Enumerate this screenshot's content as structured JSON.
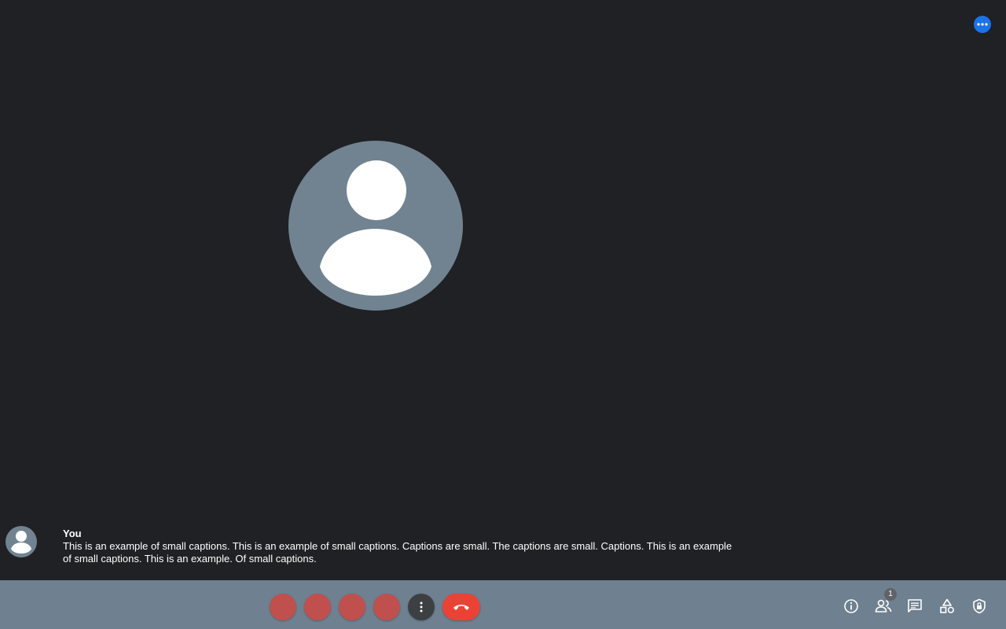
{
  "captions": {
    "speaker": "You",
    "text": "This is an example of small captions. This is an example of small captions. Captions are small. The captions are small. Captions. This is an example of small captions. This is an example. Of small captions."
  },
  "toolbar": {
    "participants_count": "1"
  },
  "colors": {
    "background": "#202124",
    "bottom_bar": "#6f8090",
    "avatar": "#718391",
    "hangup": "#ea4335",
    "control": "#c0504d",
    "accent": "#1a73e8"
  },
  "icons": {
    "overflow": "more-horizontal-icon",
    "more": "more-vertical-icon",
    "hangup": "phone-hangup-icon",
    "info": "info-icon",
    "people": "people-icon",
    "chat": "chat-icon",
    "activities": "activities-icon",
    "host_controls": "shield-lock-icon"
  }
}
